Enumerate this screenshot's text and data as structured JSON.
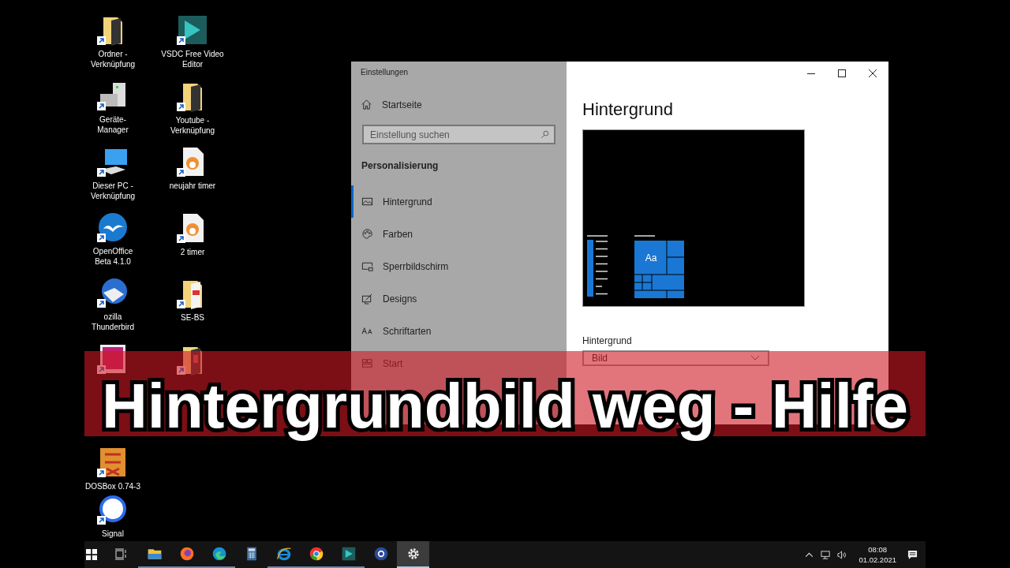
{
  "desktop": {
    "column_1": [
      {
        "kind": "folder-shortcut",
        "label": "Ordner - Verknüpfung"
      },
      {
        "kind": "device-manager",
        "label": "Geräte-Manager"
      },
      {
        "kind": "computer",
        "label": "Dieser PC - Verknüpfung"
      },
      {
        "kind": "openoffice",
        "label": "OpenOffice Beta 4.1.0"
      },
      {
        "kind": "mail",
        "label": "ozilla Thunderbird"
      },
      {
        "kind": "image"
      },
      {
        "kind": "dosbox",
        "label": "DOSBox 0.74-3"
      },
      {
        "kind": "signal",
        "label": "Signal"
      }
    ],
    "column_2": [
      {
        "kind": "video-editor",
        "label": "VSDC Free Video Editor"
      },
      {
        "kind": "folder-shortcut",
        "label": "Youtube - Verknüpfung"
      },
      {
        "kind": "cat-file",
        "label": "neujahr timer"
      },
      {
        "kind": "cat-file",
        "label": "2 timer"
      },
      {
        "kind": "pdf-folder",
        "label": "SE-BS"
      },
      {
        "kind": "folder"
      }
    ]
  },
  "settings_window": {
    "title": "Einstellungen",
    "home": "Startseite",
    "search": {
      "placeholder": "Einstellung suchen"
    },
    "section": "Personalisierung",
    "nav": [
      {
        "kind": "picture",
        "label": "Hintergrund",
        "selected": true
      },
      {
        "kind": "palette",
        "label": "Farben",
        "selected": false
      },
      {
        "kind": "lock-screen",
        "label": "Sperrbildschirm",
        "selected": false
      },
      {
        "kind": "designs",
        "label": "Designs",
        "selected": false
      },
      {
        "kind": "fonts",
        "label": "Schriftarten",
        "selected": false
      },
      {
        "kind": "start",
        "label": "Start",
        "selected": false
      }
    ],
    "heading": "Hintergrund",
    "preview": {
      "tile_label": "Aa"
    },
    "background_label": "Hintergrund",
    "background_dropdown": {
      "value": "Bild"
    }
  },
  "banner": {
    "text": "Hintergrundbild weg - Hilfe"
  },
  "taskbar": {
    "apps": [
      {
        "kind": "explorer",
        "running": true,
        "active": false
      },
      {
        "kind": "firefox",
        "running": true,
        "active": false
      },
      {
        "kind": "edge",
        "running": true,
        "active": false
      },
      {
        "kind": "calculator",
        "running": false,
        "active": false
      },
      {
        "kind": "ie",
        "running": true,
        "active": false
      },
      {
        "kind": "chrome",
        "running": true,
        "active": false
      },
      {
        "kind": "video-editor",
        "running": true,
        "active": false
      },
      {
        "kind": "camera",
        "running": false,
        "active": false
      },
      {
        "kind": "settings",
        "running": true,
        "active": true
      }
    ],
    "clock": {
      "time": "08:08",
      "date": "01.02.2021"
    }
  }
}
